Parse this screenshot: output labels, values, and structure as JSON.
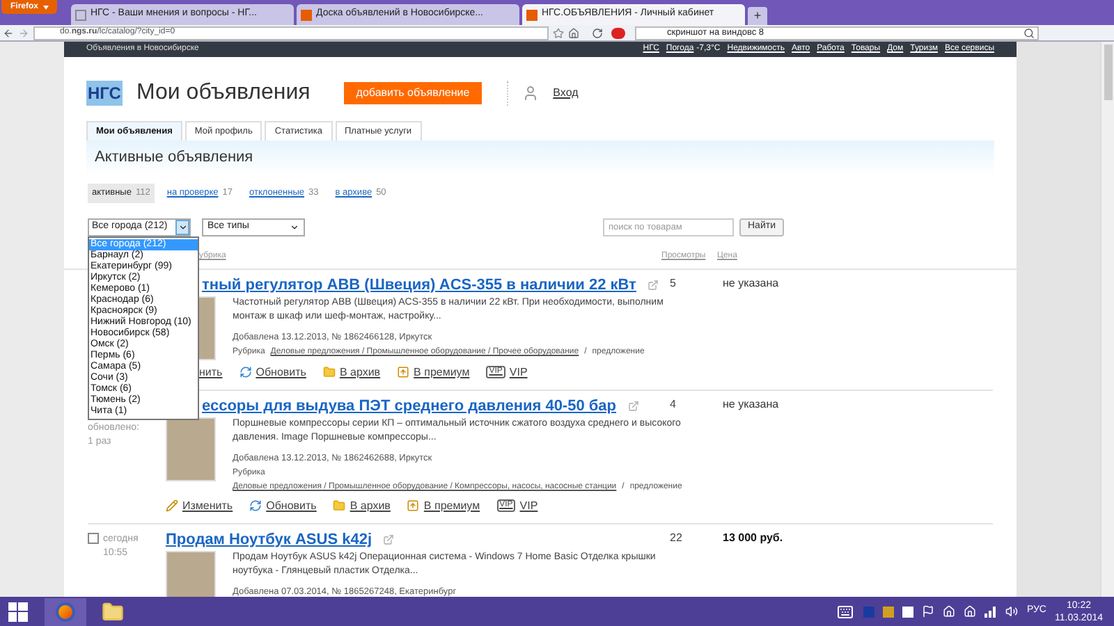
{
  "browser": {
    "menu_button": "Firefox",
    "tabs": [
      {
        "label": "НГС - Ваши мнения и вопросы - НГ...",
        "selected": false
      },
      {
        "label": "Доска объявлений в Новосибирске...",
        "selected": false
      },
      {
        "label": "НГС.ОБЪЯВЛЕНИЯ - Личный кабинет",
        "selected": true
      }
    ],
    "new_tab": "+",
    "url": "do.**ngs.ru**/lc/catalog/?city_id=0",
    "search": "скриншот на виндовс 8"
  },
  "site_bar": {
    "title": "Объявления в Новосибирске",
    "links": [
      {
        "label": "НГС"
      },
      {
        "label": "Погода",
        "note": "-7,3°C"
      },
      {
        "label": "Недвижимость"
      },
      {
        "label": "Авто"
      },
      {
        "label": "Работа"
      },
      {
        "label": "Товары"
      },
      {
        "label": "Дом"
      },
      {
        "label": "Туризм"
      },
      {
        "label": "Все сервисы"
      }
    ]
  },
  "header": {
    "logo": "НГС",
    "title": "Мои объявления",
    "add_button": "добавить объявление",
    "login": "Вход"
  },
  "tabs": [
    {
      "label": "Мои объявления",
      "selected": true
    },
    {
      "label": "Мой профиль",
      "selected": false
    },
    {
      "label": "Статистика",
      "selected": false
    },
    {
      "label": "Платные услуги",
      "selected": false
    }
  ],
  "section_title": "Активные объявления",
  "filters": [
    {
      "label": "активные",
      "count": "112",
      "selected": true
    },
    {
      "label": "на проверке",
      "count": "17",
      "selected": false
    },
    {
      "label": "отклоненные",
      "count": "33",
      "selected": false
    },
    {
      "label": "в архиве",
      "count": "50",
      "selected": false
    }
  ],
  "city_select": {
    "value": "Все города (212)",
    "expanded": true,
    "options": [
      {
        "label": "Все города (212)",
        "selected": true
      },
      {
        "label": "Барнаул (2)",
        "selected": false
      },
      {
        "label": "Екатеринбург (99)",
        "selected": false
      },
      {
        "label": "Иркутск (2)",
        "selected": false
      },
      {
        "label": "Кемерово (1)",
        "selected": false
      },
      {
        "label": "Краснодар (6)",
        "selected": false
      },
      {
        "label": "Красноярск (9)",
        "selected": false
      },
      {
        "label": "Нижний Новгород (10)",
        "selected": false
      },
      {
        "label": "Новосибирск (58)",
        "selected": false
      },
      {
        "label": "Омск (2)",
        "selected": false
      },
      {
        "label": "Пермь (6)",
        "selected": false
      },
      {
        "label": "Самара (5)",
        "selected": false
      },
      {
        "label": "Сочи (3)",
        "selected": false
      },
      {
        "label": "Томск (6)",
        "selected": false
      },
      {
        "label": "Тюмень (2)",
        "selected": false
      },
      {
        "label": "Чита (1)",
        "selected": false
      }
    ]
  },
  "type_select": {
    "value": "Все типы"
  },
  "search": {
    "placeholder": "поиск по товарам",
    "button": "Найти"
  },
  "columns": {
    "column_1": "убрика",
    "views": "Просмотры",
    "price": "Цена"
  },
  "listings": [
    {
      "title": "тный регулятор ABB (Швеция) ACS-355 в наличии 22 кВт",
      "description": "Частотный регулятор ABB (Швеция) ACS-355 в наличии 22 кВт. При необходимости, выполним монтаж в шкаф или шеф-монтаж, настройку...",
      "added": "Добавлена 13.12.2013, № 1862466128, Иркутск",
      "rubric_inline": true,
      "rubric_label": "Рубрика",
      "rubric_path": "Деловые предложения / Промышленное оборудование / Прочее оборудование",
      "rubric_separator": "/",
      "rubric_type": "предложение",
      "views": "5",
      "price": "не указана",
      "price_highlight": false,
      "actions": [
        {
          "kind": "edit",
          "label": "нить"
        },
        {
          "kind": "refresh",
          "label": "Обновить"
        },
        {
          "kind": "archive",
          "label": "В архив"
        },
        {
          "kind": "premium",
          "label": "В премиум"
        },
        {
          "kind": "vip",
          "label": "VIP",
          "badge": "VIP"
        }
      ]
    },
    {
      "meta": [
        "обновлено:",
        "1 раз"
      ],
      "title": "ессоры для выдува ПЭТ среднего давления 40-50 бар",
      "description": "Поршневые компрессоры серии КП – оптимальный источник сжатого воздуха среднего и высокого давления. Image Поршневые компрессоры...",
      "added": "Добавлена 13.12.2013, № 1862462688, Иркутск",
      "rubric_inline": false,
      "rubric_label": "Рубрика",
      "rubric_path": "Деловые предложения / Промышленное оборудование / Компрессоры, насосы, насосные станции",
      "rubric_separator": "/",
      "rubric_type": "предложение",
      "views": "4",
      "price": "не указана",
      "price_highlight": false,
      "actions": [
        {
          "kind": "edit",
          "label": "Изменить"
        },
        {
          "kind": "refresh",
          "label": "Обновить"
        },
        {
          "kind": "archive",
          "label": "В архив"
        },
        {
          "kind": "premium",
          "label": "В премиум"
        },
        {
          "kind": "vip",
          "label": "VIP",
          "badge": "VIP"
        }
      ]
    },
    {
      "checked": false,
      "meta": [
        "сегодня",
        "10:55"
      ],
      "title": "Продам Ноутбук ASUS k42j",
      "description": "Продам Ноутбук ASUS k42j Операционная система - Windows 7 Home Basic Отделка крышки ноутбука - Глянцевый пластик Отделка...",
      "added": "Добавлена 07.03.2014, № 1865267248, Екатеринбург",
      "views": "22",
      "price": "13 000 руб.",
      "price_highlight": true
    }
  ],
  "taskbar": {
    "language": "РУС",
    "time": "10:22",
    "date": "11.03.2014"
  }
}
